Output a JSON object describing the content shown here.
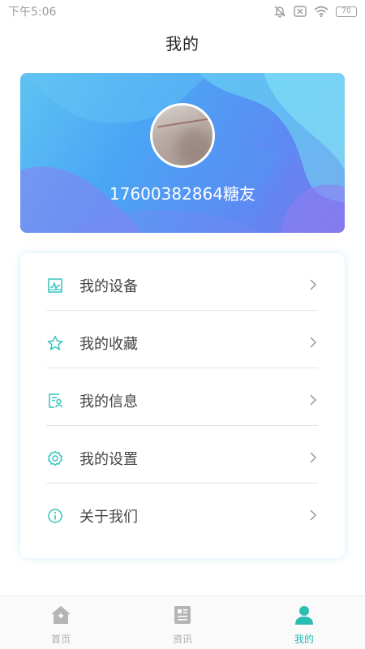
{
  "status_bar": {
    "time": "下午5:06",
    "battery": "70"
  },
  "header": {
    "title": "我的"
  },
  "profile": {
    "username": "17600382864糖友"
  },
  "menu": {
    "items": [
      {
        "label": "我的设备",
        "icon": "device-monitor-icon"
      },
      {
        "label": "我的收藏",
        "icon": "star-icon"
      },
      {
        "label": "我的信息",
        "icon": "profile-info-icon"
      },
      {
        "label": "我的设置",
        "icon": "gear-icon"
      },
      {
        "label": "关于我们",
        "icon": "info-icon"
      }
    ]
  },
  "bottom_nav": {
    "items": [
      {
        "label": "首页",
        "icon": "home-icon",
        "active": false
      },
      {
        "label": "资讯",
        "icon": "news-icon",
        "active": false
      },
      {
        "label": "我的",
        "icon": "user-icon",
        "active": true
      }
    ]
  },
  "colors": {
    "accent": "#2bbdb2",
    "icon_teal": "#35c4bd",
    "inactive": "#aaaaaa"
  }
}
